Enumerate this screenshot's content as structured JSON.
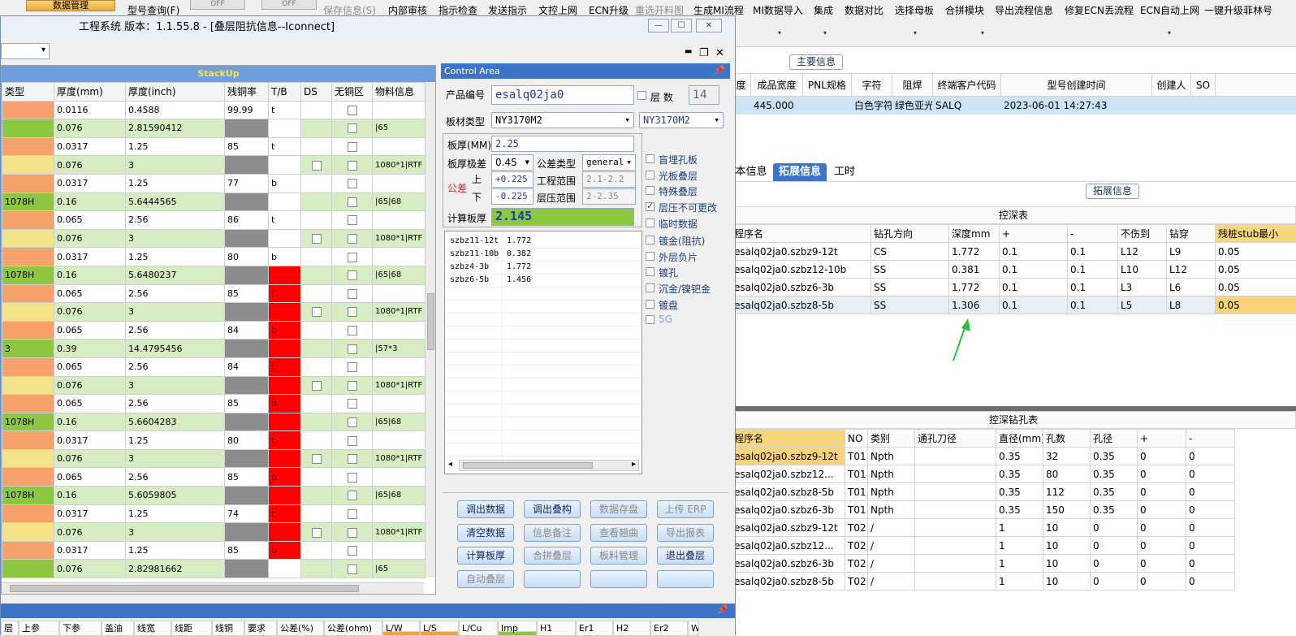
{
  "bg_toolbar": {
    "items": [
      "型号查询(F)",
      "保存信息(S)",
      "内部审核",
      "指示检查",
      "发送指示",
      "文控上网",
      "ECN升级",
      "重选开料图",
      "生成MI流程",
      "MI数据导入",
      "集成",
      "数据对比",
      "选择母板",
      "合拼模块",
      "导出流程信息",
      "修复ECN丢流程",
      "ECN自动上网",
      "一键升级菲林号"
    ],
    "disabled": [
      false,
      true,
      false,
      false,
      false,
      false,
      false,
      true,
      false,
      false,
      false,
      false,
      false,
      false,
      false,
      false,
      false,
      false
    ],
    "top_left_btn": "数据管理",
    "switch_label": "OFF"
  },
  "main_info": {
    "group_label": "主要信息",
    "headers": [
      "度",
      "成品宽度",
      "PNL规格",
      "字符",
      "阻焊",
      "终端客户代码",
      "型号创建时间",
      "创建人",
      "SO"
    ],
    "row": [
      "",
      "445.000",
      "",
      "白色字符",
      "绿色亚光",
      "SALQ",
      "2023-06-01 14:27:43",
      "",
      ""
    ]
  },
  "tabs": {
    "items": [
      "本信息",
      "拓展信息",
      "工时"
    ],
    "active": 1
  },
  "expand_group": "拓展信息",
  "depth_table": {
    "title": "控深表",
    "headers": [
      "程序名",
      "钻孔方向",
      "深度mm",
      "+",
      "-",
      "不伤到",
      "钻穿",
      "残桩stub最小"
    ],
    "rows": [
      [
        "esalq02ja0.szbz9-12t",
        "CS",
        "1.772",
        "0.1",
        "0.1",
        "L12",
        "L9",
        "0.05"
      ],
      [
        "esalq02ja0.szbz12-10b",
        "SS",
        "0.381",
        "0.1",
        "0.1",
        "L10",
        "L12",
        "0.05"
      ],
      [
        "esalq02ja0.szbz6-3b",
        "SS",
        "1.772",
        "0.1",
        "0.1",
        "L3",
        "L6",
        "0.05"
      ],
      [
        "esalq02ja0.szbz8-5b",
        "SS",
        "1.306",
        "0.1",
        "0.1",
        "L5",
        "L8",
        "0.05"
      ]
    ]
  },
  "drill_table": {
    "title": "控深钻孔表",
    "headers": [
      "程序名",
      "NO",
      "类别",
      "通孔刀径",
      "直径(mm)",
      "孔数",
      "孔径",
      "+",
      "-"
    ],
    "rows": [
      [
        "esalq02ja0.szbz9-12t",
        "T01",
        "Npth",
        "",
        "0.35",
        "32",
        "0.35",
        "0",
        "0"
      ],
      [
        "esalq02ja0.szbz12...",
        "T01",
        "Npth",
        "",
        "0.35",
        "80",
        "0.35",
        "0",
        "0"
      ],
      [
        "esalq02ja0.szbz8-5b",
        "T01",
        "Npth",
        "",
        "0.35",
        "112",
        "0.35",
        "0",
        "0"
      ],
      [
        "esalq02ja0.szbz6-3b",
        "T01",
        "Npth",
        "",
        "0.35",
        "150",
        "0.35",
        "0",
        "0"
      ],
      [
        "esalq02ja0.szbz9-12t",
        "T02",
        "/",
        "",
        "1",
        "10",
        "0",
        "0",
        "0"
      ],
      [
        "esalq02ja0.szbz12...",
        "T02",
        "/",
        "",
        "1",
        "10",
        "0",
        "0",
        "0"
      ],
      [
        "esalq02ja0.szbz6-3b",
        "T02",
        "/",
        "",
        "1",
        "10",
        "0",
        "0",
        "0"
      ],
      [
        "esalq02ja0.szbz8-5b",
        "T02",
        "/",
        "",
        "1",
        "10",
        "0",
        "0",
        "0"
      ]
    ]
  },
  "window": {
    "title": "工程系统  版本：1.1.55.8 - [叠层阻抗信息--Iconnect]",
    "min": "—",
    "max": "☐",
    "close": "✕",
    "mdi_min": "▬",
    "mdi_restore": "❐",
    "mdi_close": "✕"
  },
  "stackup": {
    "title": "StackUp",
    "headers": [
      "类型",
      "厚度(mm)",
      "厚度(inch)",
      "残铜率",
      "T/B",
      "DS",
      "无铜区",
      "物料信息"
    ],
    "rows": [
      {
        "type": "",
        "mm": "0.0116",
        "inch": "0.4588",
        "cu": "99.99",
        "tb": "t",
        "ds": false,
        "info": "",
        "color": "#f5a26a",
        "cugray": false,
        "tbred": false
      },
      {
        "type": "",
        "mm": "0.076",
        "inch": "2.81590412",
        "cu": "",
        "tb": "",
        "ds": false,
        "info": "|65",
        "color": "#8dc63f",
        "cugray": true,
        "tbred": false
      },
      {
        "type": "",
        "mm": "0.0317",
        "inch": "1.25",
        "cu": "85",
        "tb": "t",
        "ds": false,
        "info": "",
        "color": "#f5a26a",
        "cugray": false,
        "tbred": false
      },
      {
        "type": "",
        "mm": "0.076",
        "inch": "3",
        "cu": "",
        "tb": "",
        "ds": true,
        "info": "1080*1|RTF",
        "color": "#f2e28a",
        "cugray": true,
        "tbred": false
      },
      {
        "type": "",
        "mm": "0.0317",
        "inch": "1.25",
        "cu": "77",
        "tb": "b",
        "ds": false,
        "info": "",
        "color": "#f5a26a",
        "cugray": false,
        "tbred": false
      },
      {
        "type": "1078H",
        "mm": "0.16",
        "inch": "5.6444565",
        "cu": "",
        "tb": "",
        "ds": false,
        "info": "|65|68",
        "color": "#8dc63f",
        "cugray": true,
        "tbred": false
      },
      {
        "type": "",
        "mm": "0.065",
        "inch": "2.56",
        "cu": "86",
        "tb": "t",
        "ds": false,
        "info": "",
        "color": "#f5a26a",
        "cugray": false,
        "tbred": false
      },
      {
        "type": "",
        "mm": "0.076",
        "inch": "3",
        "cu": "",
        "tb": "",
        "ds": true,
        "info": "1080*1|RTF",
        "color": "#f2e28a",
        "cugray": true,
        "tbred": false
      },
      {
        "type": "",
        "mm": "0.0317",
        "inch": "1.25",
        "cu": "80",
        "tb": "b",
        "ds": false,
        "info": "",
        "color": "#f5a26a",
        "cugray": false,
        "tbred": false
      },
      {
        "type": "1078H",
        "mm": "0.16",
        "inch": "5.6480237",
        "cu": "",
        "tb": "",
        "ds": false,
        "info": "|65|68",
        "color": "#8dc63f",
        "cugray": true,
        "tbred": true
      },
      {
        "type": "",
        "mm": "0.065",
        "inch": "2.56",
        "cu": "85",
        "tb": "t",
        "ds": false,
        "info": "",
        "color": "#f5a26a",
        "cugray": false,
        "tbred": true
      },
      {
        "type": "",
        "mm": "0.076",
        "inch": "3",
        "cu": "",
        "tb": "",
        "ds": true,
        "info": "1080*1|RTF",
        "color": "#f2e28a",
        "cugray": true,
        "tbred": true
      },
      {
        "type": "",
        "mm": "0.065",
        "inch": "2.56",
        "cu": "84",
        "tb": "b",
        "ds": false,
        "info": "",
        "color": "#f5a26a",
        "cugray": false,
        "tbred": true
      },
      {
        "type": "3",
        "mm": "0.39",
        "inch": "14.4795456",
        "cu": "",
        "tb": "",
        "ds": false,
        "info": "|57*3",
        "color": "#8dc63f",
        "cugray": true,
        "tbred": true
      },
      {
        "type": "",
        "mm": "0.065",
        "inch": "2.56",
        "cu": "84",
        "tb": "t",
        "ds": false,
        "info": "",
        "color": "#f5a26a",
        "cugray": false,
        "tbred": true
      },
      {
        "type": "",
        "mm": "0.076",
        "inch": "3",
        "cu": "",
        "tb": "",
        "ds": true,
        "info": "1080*1|RTF",
        "color": "#f2e28a",
        "cugray": true,
        "tbred": true
      },
      {
        "type": "",
        "mm": "0.065",
        "inch": "2.56",
        "cu": "85",
        "tb": "b",
        "ds": false,
        "info": "",
        "color": "#f5a26a",
        "cugray": false,
        "tbred": true
      },
      {
        "type": "1078H",
        "mm": "0.16",
        "inch": "5.6604283",
        "cu": "",
        "tb": "",
        "ds": false,
        "info": "|65|68",
        "color": "#8dc63f",
        "cugray": true,
        "tbred": true
      },
      {
        "type": "",
        "mm": "0.0317",
        "inch": "1.25",
        "cu": "80",
        "tb": "t",
        "ds": false,
        "info": "",
        "color": "#f5a26a",
        "cugray": false,
        "tbred": true
      },
      {
        "type": "",
        "mm": "0.076",
        "inch": "3",
        "cu": "",
        "tb": "",
        "ds": true,
        "info": "1080*1|RTF",
        "color": "#f2e28a",
        "cugray": true,
        "tbred": true
      },
      {
        "type": "",
        "mm": "0.065",
        "inch": "2.56",
        "cu": "85",
        "tb": "b",
        "ds": false,
        "info": "",
        "color": "#f5a26a",
        "cugray": false,
        "tbred": true
      },
      {
        "type": "1078H",
        "mm": "0.16",
        "inch": "5.6059805",
        "cu": "",
        "tb": "",
        "ds": false,
        "info": "|65|68",
        "color": "#8dc63f",
        "cugray": true,
        "tbred": true
      },
      {
        "type": "",
        "mm": "0.0317",
        "inch": "1.25",
        "cu": "74",
        "tb": "t",
        "ds": false,
        "info": "",
        "color": "#f5a26a",
        "cugray": false,
        "tbred": true
      },
      {
        "type": "",
        "mm": "0.076",
        "inch": "3",
        "cu": "",
        "tb": "",
        "ds": true,
        "info": "1080*1|RTF",
        "color": "#f2e28a",
        "cugray": true,
        "tbred": true
      },
      {
        "type": "",
        "mm": "0.0317",
        "inch": "1.25",
        "cu": "85",
        "tb": "b",
        "ds": false,
        "info": "",
        "color": "#f5a26a",
        "cugray": false,
        "tbred": true
      },
      {
        "type": "",
        "mm": "0.076",
        "inch": "2.82981662",
        "cu": "",
        "tb": "",
        "ds": false,
        "info": "|65",
        "color": "#8dc63f",
        "cugray": true,
        "tbred": false
      }
    ]
  },
  "control": {
    "title": "Control Area",
    "product_label": "产品编号",
    "product_value": "esalq02ja0",
    "layers_label": "层 数",
    "layers_value": "14",
    "material_label": "板材类型",
    "material_value": "NY3170M2",
    "material_value2": "NY3170M2",
    "thickness_label": "板厚(MM)",
    "thickness_value": "2.25",
    "tolerance_limit_label": "板厚极差",
    "tolerance_limit_value": "0.45",
    "tolerance_type_label": "公差类型",
    "tolerance_type_value": "general",
    "tol_label": "公差",
    "upper_label": "上",
    "lower_label": "下",
    "upper_value": "+0.225",
    "lower_value": "-0.225",
    "eng_range_label": "工程范围",
    "eng_range_value": "2.1-2.2",
    "press_range_label": "层压范围",
    "press_range_value": "2-2.35",
    "calc_label": "计算板厚",
    "calc_value": "2.145",
    "list": [
      {
        "name": "szbz11-12t",
        "val": "1.772"
      },
      {
        "name": "szbz11-10b",
        "val": "0.382"
      },
      {
        "name": "szbz4-3b",
        "val": "1.772"
      },
      {
        "name": "szbz6-5b",
        "val": "1.456"
      }
    ],
    "checks": [
      {
        "label": "盲埋孔板",
        "checked": false
      },
      {
        "label": "光板叠层",
        "checked": false
      },
      {
        "label": "特殊叠层",
        "checked": false
      },
      {
        "label": "层压不可更改",
        "checked": true
      },
      {
        "label": "临时数据",
        "checked": false
      },
      {
        "label": "镀金(阻抗)",
        "checked": false
      },
      {
        "label": "外层负片",
        "checked": false
      },
      {
        "label": "镀孔",
        "checked": false
      },
      {
        "label": "沉金/镍钯金",
        "checked": false
      },
      {
        "label": "镀盘",
        "checked": false
      },
      {
        "label": "5G",
        "checked": false
      }
    ],
    "buttons": [
      {
        "label": "调出数据",
        "enabled": true
      },
      {
        "label": "调出叠构",
        "enabled": true
      },
      {
        "label": "数据存盘",
        "enabled": false
      },
      {
        "label": "上传 ERP",
        "enabled": false
      },
      {
        "label": "清空数据",
        "enabled": true
      },
      {
        "label": "信息备注",
        "enabled": false
      },
      {
        "label": "查看翘曲",
        "enabled": false
      },
      {
        "label": "导出报表",
        "enabled": false
      },
      {
        "label": "计算板厚",
        "enabled": true
      },
      {
        "label": "合拼叠层",
        "enabled": false
      },
      {
        "label": "板料管理",
        "enabled": false
      },
      {
        "label": "退出叠层",
        "enabled": true
      },
      {
        "label": "自动叠层",
        "enabled": false
      },
      {
        "label": "",
        "enabled": false
      },
      {
        "label": "",
        "enabled": false
      },
      {
        "label": "",
        "enabled": false
      }
    ]
  },
  "bottom_grid": {
    "headers": [
      "层",
      "上参",
      "下参",
      "盖油",
      "线宽",
      "线距",
      "线铜",
      "要求",
      "公差(%)",
      "公差(ohm)",
      "L/W",
      "L/S",
      "L/Cu",
      "Imp",
      "H1",
      "Er1",
      "H2",
      "Er2",
      "W"
    ]
  },
  "colors": {
    "accent": "#3d74c9",
    "copper": "#f5a26a",
    "core": "#8dc63f",
    "pp": "#f2e28a",
    "red": "#ff0000",
    "gray": "#8c8c8c",
    "arrow": "#29c23c"
  }
}
